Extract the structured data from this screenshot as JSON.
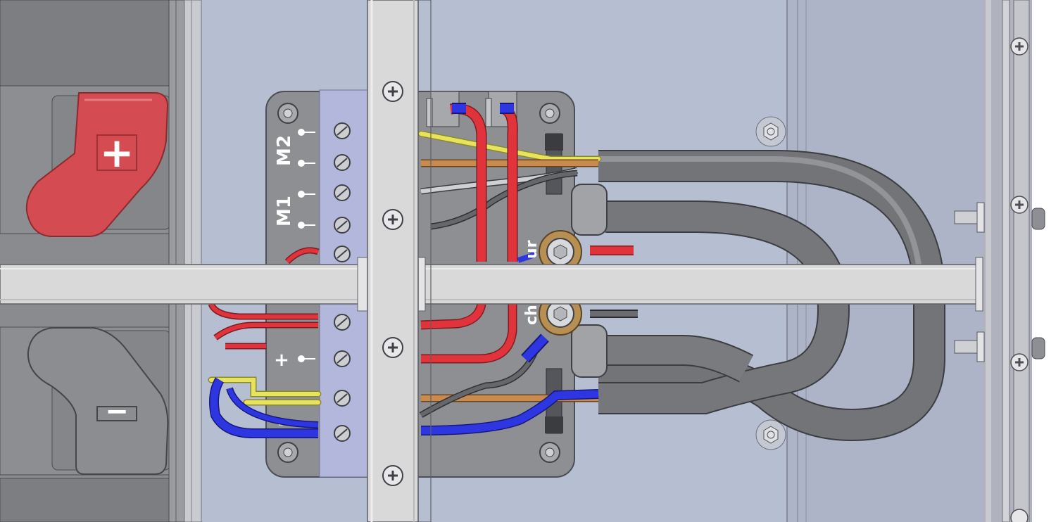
{
  "terminal_block_labels": {
    "motor_2": "M2",
    "motor_1": "M1",
    "plus": "+",
    "minus": "-"
  },
  "partial_labels": {
    "upper_lug": "ur",
    "lower_lug": "ch"
  },
  "battery_terminals": {
    "positive_symbol": "+",
    "negative_symbol": "−"
  },
  "colors": {
    "background_panel": "#b6bfd2",
    "right_panel": "#a9b0c4",
    "terminal_block_plate": "#8e8f92",
    "terminal_block_insert": "#b4b7dc",
    "rail": "#d9d9d9",
    "wire_red": "#e0333c",
    "wire_blue": "#2d36e0",
    "wire_yellow": "#e7e35a",
    "wire_brown": "#c98a4e",
    "wire_grey": "#55575c",
    "cable_sheath": "#6f7074",
    "battery_positive_cap": "#d44c52",
    "battery_negative_cap": "#8c8d90"
  }
}
